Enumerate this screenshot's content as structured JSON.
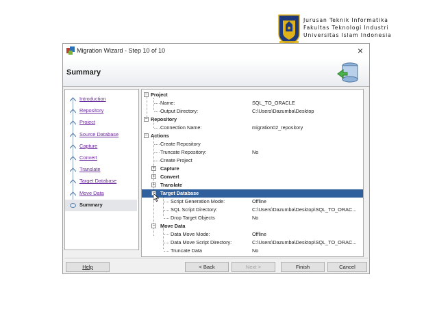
{
  "institution": {
    "lines": [
      "Jurusan Teknik Informatika",
      "Fakultas Teknologi Industri",
      "Universitas Islam Indonesia"
    ]
  },
  "window": {
    "title": "Migration Wizard - Step 10 of 10",
    "close_glyph": "×",
    "heading": "Summary"
  },
  "steps": [
    {
      "label": "Introduction",
      "current": false
    },
    {
      "label": "Repository",
      "current": false
    },
    {
      "label": "Project",
      "current": false
    },
    {
      "label": "Source Database",
      "current": false
    },
    {
      "label": "Capture",
      "current": false
    },
    {
      "label": "Convert",
      "current": false
    },
    {
      "label": "Translate",
      "current": false
    },
    {
      "label": "Target Database",
      "current": false
    },
    {
      "label": "Move Data",
      "current": false
    },
    {
      "label": "Summary",
      "current": true
    }
  ],
  "tree": {
    "project": {
      "label": "Project"
    },
    "project_name": {
      "key": "Name:",
      "value": "SQL_TO_ORACLE"
    },
    "project_outdir": {
      "key": "Output Directory:",
      "value": "C:\\Users\\Dazumba\\Desktop"
    },
    "repository": {
      "label": "Repository"
    },
    "repo_conn": {
      "key": "Connection Name:",
      "value": "migration02_repository"
    },
    "actions": {
      "label": "Actions"
    },
    "create_repo": {
      "key": "Create Repository",
      "value": ""
    },
    "truncate_repo": {
      "key": "Truncate Repository:",
      "value": "No"
    },
    "create_project": {
      "key": "Create Project",
      "value": ""
    },
    "capture": {
      "label": "Capture"
    },
    "convert": {
      "label": "Convert"
    },
    "translate": {
      "label": "Translate"
    },
    "target_db": {
      "label": "Target Database"
    },
    "script_gen": {
      "key": "Script Generation Mode:",
      "value": "Offline"
    },
    "sql_script_dir": {
      "key": "SQL Script Directory:",
      "value": "C:\\Users\\Dazumba\\Desktop\\SQL_TO_ORAC..."
    },
    "drop_target": {
      "key": "Drop Target Objects",
      "value": "No"
    },
    "move_data": {
      "label": "Move Data"
    },
    "data_move_mode": {
      "key": "Data Move Mode:",
      "value": "Offline"
    },
    "data_move_dir": {
      "key": "Data Move Script Directory:",
      "value": "C:\\Users\\Dazumba\\Desktop\\SQL_TO_ORAC..."
    },
    "truncate_data": {
      "key": "Truncate Data",
      "value": "No"
    }
  },
  "buttons": {
    "help": "Help",
    "back": "< Back",
    "next": "Next >",
    "finish": "Finish",
    "cancel": "Cancel"
  },
  "colors": {
    "selection": "#2f5f9c",
    "link": "#6b2a9e",
    "logo_blue": "#1f3a7a",
    "logo_gold": "#e0b21a"
  }
}
